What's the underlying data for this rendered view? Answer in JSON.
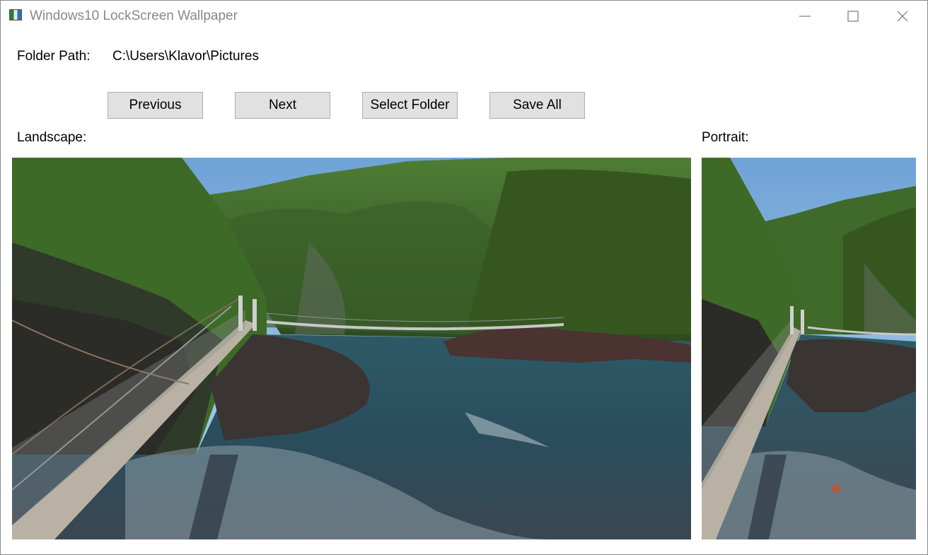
{
  "window": {
    "title": "Windows10 LockScreen Wallpaper",
    "icons": [
      "app-icon",
      "minimize-icon",
      "maximize-icon",
      "close-icon"
    ]
  },
  "folder": {
    "label": "Folder Path:",
    "path": "C:\\Users\\Klavor\\Pictures"
  },
  "buttons": {
    "previous": "Previous",
    "next": "Next",
    "select_folder": "Select Folder",
    "save_all": "Save All"
  },
  "landscape": {
    "label": "Landscape:"
  },
  "portrait": {
    "label": "Portrait:"
  },
  "colors": {
    "button_bg": "#e1e1e1",
    "button_border": "#adadad",
    "title_text": "#888888"
  }
}
